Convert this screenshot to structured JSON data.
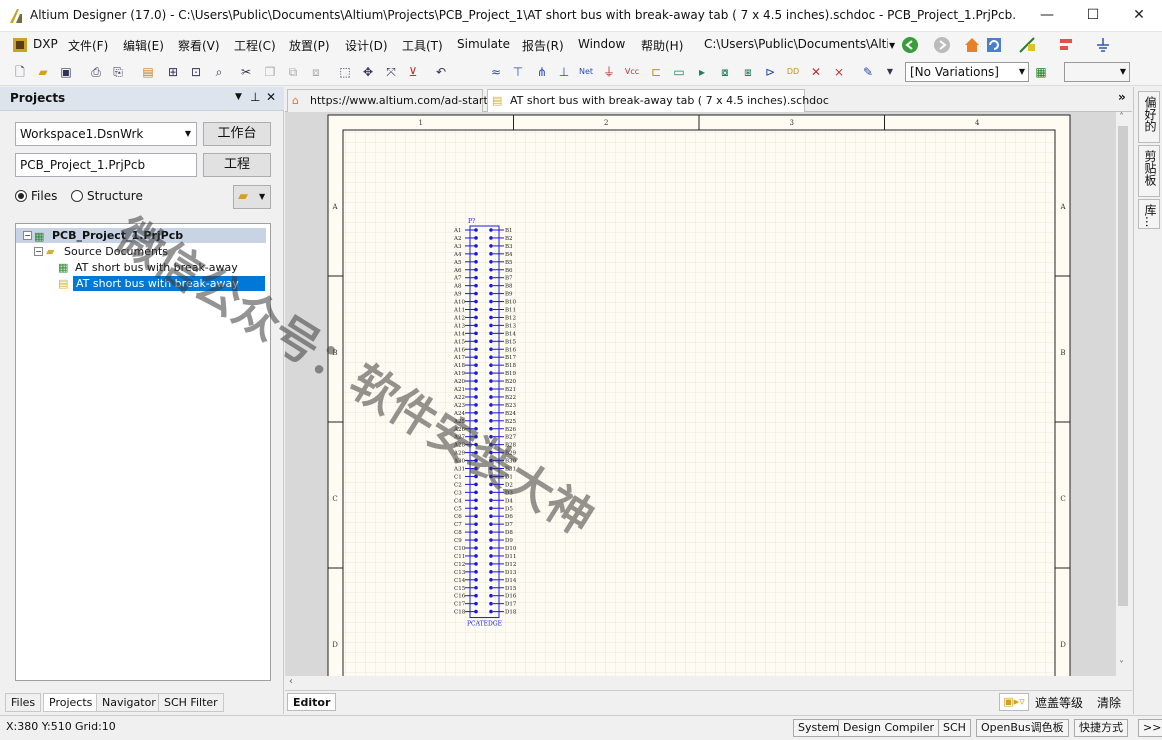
{
  "window": {
    "title": "Altium Designer (17.0) - C:\\Users\\Public\\Documents\\Altium\\Projects\\PCB_Project_1\\AT short bus with break-away tab ( 7 x 4.5 inches).schdoc - PCB_Project_1.PrjPcb. Not ...",
    "minimize": "—",
    "maximize": "☐",
    "close": "✕"
  },
  "menu": {
    "items": [
      "DXP",
      "文件(F)",
      "编辑(E)",
      "察看(V)",
      "工程(C)",
      "放置(P)",
      "设计(D)",
      "工具(T)",
      "Simulate",
      "报告(R)",
      "Window",
      "帮助(H)"
    ],
    "path_combo": "C:\\Users\\Public\\Documents\\Alti"
  },
  "toolbar": {
    "variations": "[No Variations]"
  },
  "projects_panel": {
    "title": "Projects",
    "workspace": "Workspace1.DsnWrk",
    "workspace_btn": "工作台",
    "project": "PCB_Project_1.PrjPcb",
    "project_btn": "工程",
    "radio_files": "Files",
    "radio_structure": "Structure",
    "tree": {
      "project": "PCB_Project_1.PrjPcb",
      "folder": "Source Documents",
      "doc1": "AT short bus with break-away",
      "doc2": "AT short bus with break-away"
    },
    "bottom_tabs": [
      "Files",
      "Projects",
      "Navigator",
      "SCH Filter"
    ]
  },
  "doc_tabs": {
    "home": "https://www.altium.com/ad-start/",
    "schematic": "AT short bus with break-away tab ( 7 x 4.5 inches).schdoc"
  },
  "sheet": {
    "cols": [
      "1",
      "2",
      "3",
      "4"
    ],
    "rows": [
      "A",
      "B",
      "C",
      "D"
    ],
    "part_designator": "P?",
    "part_comment": "PCATEDGE",
    "pins_left": [
      "A1",
      "A2",
      "A3",
      "A4",
      "A5",
      "A6",
      "A7",
      "A8",
      "A9",
      "A10",
      "A11",
      "A12",
      "A13",
      "A14",
      "A15",
      "A16",
      "A17",
      "A18",
      "A19",
      "A20",
      "A21",
      "A22",
      "A23",
      "A24",
      "A25",
      "A26",
      "A27",
      "A28",
      "A29",
      "A30",
      "A31",
      "C1",
      "C2",
      "C3",
      "C4",
      "C5",
      "C6",
      "C7",
      "C8",
      "C9",
      "C10",
      "C11",
      "C12",
      "C13",
      "C14",
      "C15",
      "C16",
      "C17",
      "C18"
    ],
    "pins_right": [
      "B1",
      "B2",
      "B3",
      "B4",
      "B5",
      "B6",
      "B7",
      "B8",
      "B9",
      "B10",
      "B11",
      "B12",
      "B13",
      "B14",
      "B15",
      "B16",
      "B17",
      "B18",
      "B19",
      "B20",
      "B21",
      "B22",
      "B23",
      "B24",
      "B25",
      "B26",
      "B27",
      "B28",
      "B29",
      "B30",
      "B31",
      "D1",
      "D2",
      "D3",
      "D4",
      "D5",
      "D6",
      "D7",
      "D8",
      "D9",
      "D10",
      "D11",
      "D12",
      "D13",
      "D14",
      "D15",
      "D16",
      "D17",
      "D18"
    ]
  },
  "editor_bar": {
    "tab": "Editor",
    "mask_level": "遮盖等级",
    "clear": "清除"
  },
  "right_panel": [
    "偏好的",
    "剪贴板",
    "库..."
  ],
  "status": {
    "coords": "X:380 Y:510",
    "grid": "Grid:10",
    "buttons": [
      "System",
      "Design Compiler",
      "SCH",
      "OpenBus调色板",
      "快捷方式"
    ],
    "more": ">>"
  },
  "watermark": "微信公众号：软件安装大神",
  "colors": {
    "pin_blue": "#1a1ad8",
    "selection": "#0078d7",
    "sheet_bg": "#fefcf2"
  }
}
